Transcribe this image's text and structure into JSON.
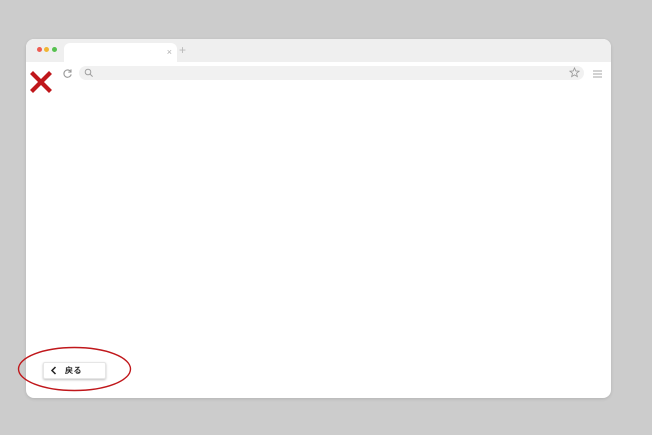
{
  "browser": {
    "tab_close_glyph": "×",
    "new_tab_glyph": "+",
    "omnibox_value": "",
    "icons": [
      "reload-icon",
      "search-icon",
      "bookmark-star-icon",
      "hamburger-menu-icon"
    ]
  },
  "annotation": {
    "mark_icon": "close-x-icon",
    "mark_color": "#c0171b",
    "highlight_color": "#c0171b"
  },
  "back_button": {
    "icon": "chevron-left-icon",
    "label": "戻る"
  },
  "colors": {
    "background": "#cccccc",
    "window": "#ffffff",
    "tabstrip": "#efefef"
  }
}
